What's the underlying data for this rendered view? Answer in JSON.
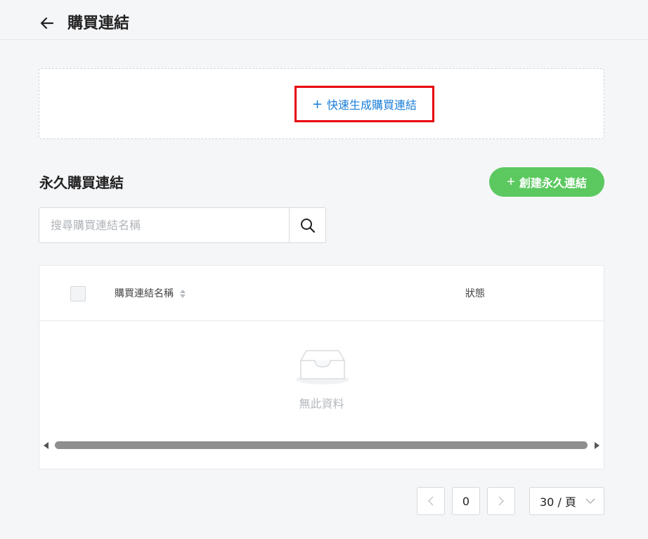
{
  "header": {
    "title": "購買連結"
  },
  "quick": {
    "label": "快速生成購買連結"
  },
  "section": {
    "title": "永久購買連結",
    "create_label": "創建永久連結"
  },
  "search": {
    "placeholder": "搜尋購買連結名稱",
    "value": ""
  },
  "table": {
    "columns": [
      "購買連結名稱",
      "狀態"
    ],
    "rows": [],
    "empty_text": "無此資料"
  },
  "pagination": {
    "current_page": "0",
    "page_size": "30 / 頁"
  },
  "colors": {
    "accent_blue": "#1a7ed8",
    "primary_green": "#5cc960",
    "highlight_red": "#e8000b"
  }
}
